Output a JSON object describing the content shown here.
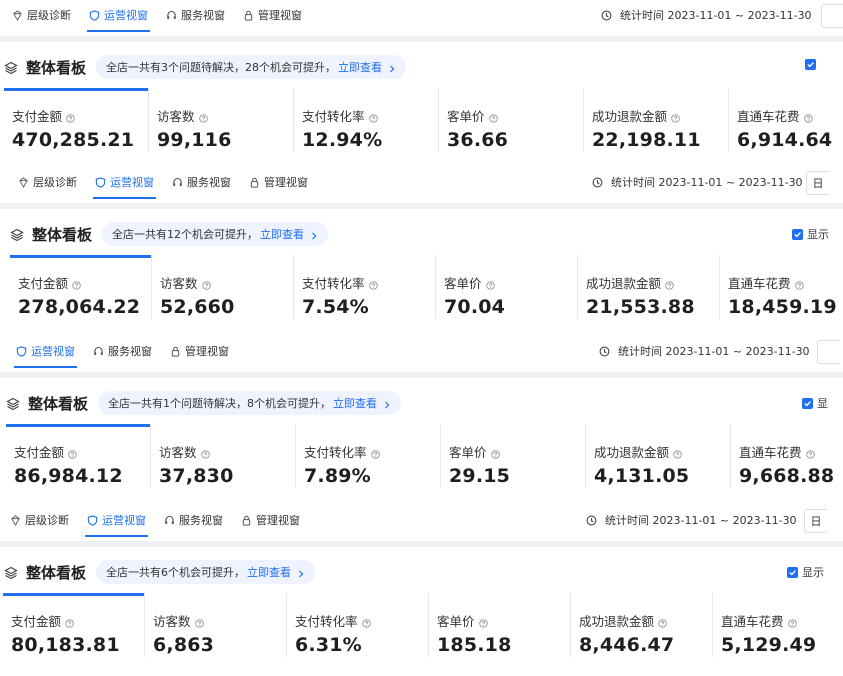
{
  "icons": {
    "tab_level": "diamond-icon",
    "tab_ops": "shield-icon",
    "tab_service": "headset-icon",
    "tab_manage": "lock-icon",
    "stat_time": "clock-icon",
    "board": "layers-icon",
    "metric_help": "question-circle-icon",
    "notice_link": "chevron-right-icon",
    "check": "checkmark-icon"
  },
  "colors": {
    "accent": "#1f6ff0",
    "divider": "#eef0f4",
    "notice_bg": "#eef3ff"
  },
  "panels": [
    {
      "tabs": [
        {
          "label": "层级诊断",
          "active": false
        },
        {
          "label": "运营视窗",
          "active": true
        },
        {
          "label": "服务视窗",
          "active": false
        },
        {
          "label": "管理视窗",
          "active": false
        }
      ],
      "stat_time": "统计时间 2023-11-01 ~ 2023-11-30",
      "date_box": "",
      "board_title": "整体看板",
      "notice_text": "全店一共有3个问题待解决，28个机会可提升，",
      "notice_link": "立即查看",
      "right_check_label": "",
      "metrics": [
        {
          "label": "支付金额",
          "value": "470,285.21"
        },
        {
          "label": "访客数",
          "value": "99,116"
        },
        {
          "label": "支付转化率",
          "value": "12.94%"
        },
        {
          "label": "客单价",
          "value": "36.66"
        },
        {
          "label": "成功退款金额",
          "value": "22,198.11"
        },
        {
          "label": "直通车花费",
          "value": "6,914.64"
        }
      ]
    },
    {
      "tabs": [
        {
          "label": "层级诊断",
          "active": false
        },
        {
          "label": "运营视窗",
          "active": true
        },
        {
          "label": "服务视窗",
          "active": false
        },
        {
          "label": "管理视窗",
          "active": false
        }
      ],
      "stat_time": "统计时间 2023-11-01 ~ 2023-11-30",
      "date_box": "日",
      "board_title": "整体看板",
      "notice_text": "全店一共有12个机会可提升，",
      "notice_link": "立即查看",
      "right_check_label": "显示",
      "metrics": [
        {
          "label": "支付金额",
          "value": "278,064.22"
        },
        {
          "label": "访客数",
          "value": "52,660"
        },
        {
          "label": "支付转化率",
          "value": "7.54%"
        },
        {
          "label": "客单价",
          "value": "70.04"
        },
        {
          "label": "成功退款金额",
          "value": "21,553.88"
        },
        {
          "label": "直通车花费",
          "value": "18,459.19"
        }
      ]
    },
    {
      "tabs": [
        {
          "label": "运营视窗",
          "active": true
        },
        {
          "label": "服务视窗",
          "active": false
        },
        {
          "label": "管理视窗",
          "active": false
        }
      ],
      "stat_time": "统计时间 2023-11-01 ~ 2023-11-30",
      "date_box": "",
      "board_title": "整体看板",
      "notice_text": "全店一共有1个问题待解决，8个机会可提升，",
      "notice_link": "立即查看",
      "right_check_label": "显",
      "metrics": [
        {
          "label": "支付金额",
          "value": "86,984.12"
        },
        {
          "label": "访客数",
          "value": "37,830"
        },
        {
          "label": "支付转化率",
          "value": "7.89%"
        },
        {
          "label": "客单价",
          "value": "29.15"
        },
        {
          "label": "成功退款金额",
          "value": "4,131.05"
        },
        {
          "label": "直通车花费",
          "value": "9,668.88"
        }
      ]
    },
    {
      "tabs": [
        {
          "label": "层级诊断",
          "active": false
        },
        {
          "label": "运营视窗",
          "active": true
        },
        {
          "label": "服务视窗",
          "active": false
        },
        {
          "label": "管理视窗",
          "active": false
        }
      ],
      "stat_time": "统计时间 2023-11-01 ~ 2023-11-30",
      "date_box": "日",
      "board_title": "整体看板",
      "notice_text": "全店一共有6个机会可提升，",
      "notice_link": "立即查看",
      "right_check_label": "显示",
      "metrics": [
        {
          "label": "支付金额",
          "value": "80,183.81"
        },
        {
          "label": "访客数",
          "value": "6,863"
        },
        {
          "label": "支付转化率",
          "value": "6.31%"
        },
        {
          "label": "客单价",
          "value": "185.18"
        },
        {
          "label": "成功退款金额",
          "value": "8,446.47"
        },
        {
          "label": "直通车花费",
          "value": "5,129.49"
        }
      ]
    }
  ]
}
